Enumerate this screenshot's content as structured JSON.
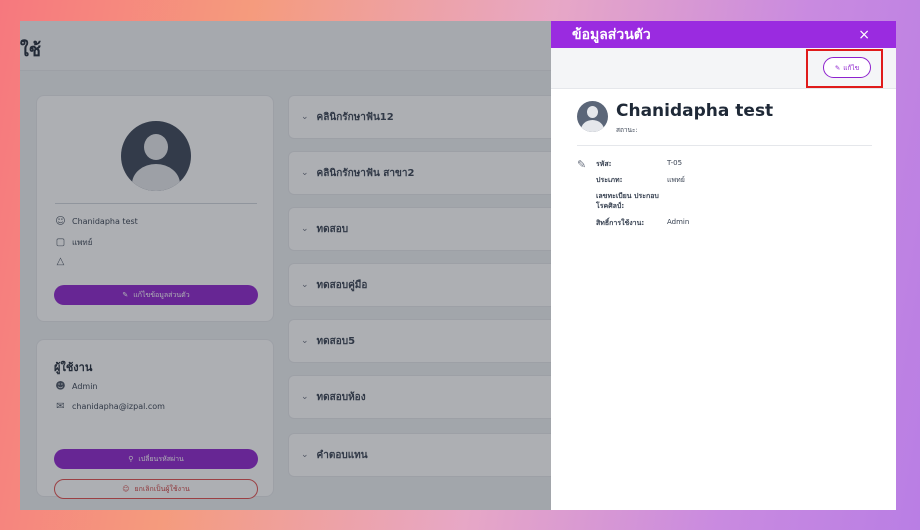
{
  "background_page": {
    "title_partial": "ใช้",
    "profile_card": {
      "name": "Chanidapha test",
      "role": "แพทย์",
      "edit_profile_button": "แก้ไขข้อมูลส่วนตัว"
    },
    "user_card": {
      "heading": "ผู้ใช้งาน",
      "permission": "Admin",
      "email": "chanidapha@izpal.com",
      "change_password_button": "เปลี่ยนรหัสผ่าน",
      "cancel_user_button": "ยกเลิกเป็นผู้ใช้งาน"
    },
    "clinics": [
      {
        "label": "คลินิกรักษาฟัน12"
      },
      {
        "label": "คลินิกรักษาฟัน สาขา2"
      },
      {
        "label": "ทดสอบ"
      },
      {
        "label": "ทดสอบคู่มือ"
      },
      {
        "label": "ทดสอบ5"
      },
      {
        "label": "ทดสอบห้อง"
      },
      {
        "label": "คำตอบแทน"
      }
    ]
  },
  "panel": {
    "title": "ข้อมูลส่วนตัว",
    "close_label": "×",
    "edit_button_label": "แก้ไข",
    "name": "Chanidapha test",
    "status_label": "สถานะ:",
    "fields": [
      {
        "label": "รหัส:",
        "value": "T-05"
      },
      {
        "label": "ประเภท:",
        "value": "แพทย์"
      },
      {
        "label": "เลขทะเบียน ประกอบโรคศิลป์:",
        "value": ""
      },
      {
        "label": "สิทธิ์การใช้งาน:",
        "value": "Admin"
      }
    ]
  },
  "colors": {
    "accent_purple": "#9a2be0",
    "button_purple": "#8e22ce",
    "highlight_red": "#e01b1b"
  }
}
